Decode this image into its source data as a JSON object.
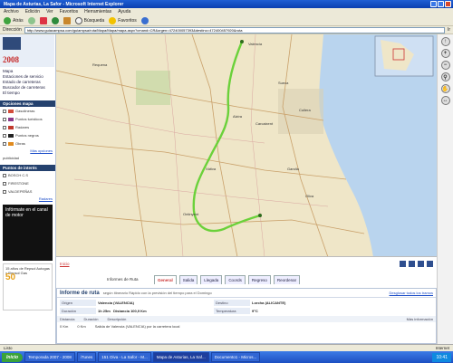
{
  "window": {
    "title": "Mapa de Asturias, La Safor - Microsoft Internet Explorer"
  },
  "menu": [
    "Archivo",
    "Edición",
    "Ver",
    "Favoritos",
    "Herramientas",
    "Ayuda"
  ],
  "toolbar": {
    "back": "Atrás",
    "search": "Búsqueda",
    "favorites": "Favoritos"
  },
  "address": {
    "label": "Dirección",
    "url": "http://www.guiacampsa.com/guiampsa/ruta/Mapa/Mapa/mapa.aspx?cmand=CR&orgen=472400057393&destino=472400457920&ruta",
    "go": "Ir"
  },
  "sidebar": {
    "year": "2008",
    "links": [
      "Mapa",
      "Estaciones de servicio",
      "Estado de carreteras",
      "Buscador de carreteras",
      "El tiempo"
    ],
    "options_title": "Opciones mapa",
    "options": [
      {
        "label": "Gasolineras",
        "color": "#d24c3a"
      },
      {
        "label": "Puntos turísticos",
        "color": "#8b3a8b"
      },
      {
        "label": "Radares",
        "color": "#c0392b"
      },
      {
        "label": "Puntos negros",
        "color": "#222"
      },
      {
        "label": "Obras",
        "color": "#e08a1e"
      }
    ],
    "more_options": "Más opciones",
    "pub_title": "publicidad",
    "points_title": "Puntos de interés",
    "points": [
      "BOSCH C.S",
      "FIRESTONE",
      "VALDEPEÑAS"
    ],
    "radars_link": "Radares",
    "ad1": "Infórmate en el canal de motor",
    "ad2_line": "15 años de Repsol Autogas y Repsol Gas",
    "ad2_big": "50"
  },
  "map": {
    "cities": [
      "Valencia",
      "Alzira",
      "Carcaixent",
      "Xàtiva",
      "Gandia",
      "Oliva",
      "Ontinyent",
      "Sueca",
      "Cullera",
      "Requena"
    ],
    "sea_color": "#b9d4ee",
    "route_color": "#6bd13a"
  },
  "under": {
    "link": "Inicio"
  },
  "tabs": {
    "lead": "Informes de Ruta",
    "items": [
      "General",
      "Salida",
      "Llegada",
      "Coords",
      "Regreso",
      "Reordenar"
    ],
    "active": 0
  },
  "report": {
    "title": "Informe de ruta",
    "subtitle": "según itinerario Rápido con la previsión del tiempo para el Domingo",
    "detail_link": "Desglosar todos los tramos",
    "origin_label": "Origen",
    "origin": "Valencia (VALENCIA)",
    "dest_label": "Destino",
    "dest": "Lorcha (ALICANTE)",
    "duration_label": "Duración",
    "duration": "1h 25m",
    "distance_label": "Distancia",
    "distance": "100,9 Km",
    "temp_label": "Temperatura",
    "temp": "9°C",
    "summary": [
      "Distancia",
      "Duración",
      "Descripción",
      "Más información"
    ],
    "step": [
      "0 Km",
      "0 Km",
      "Salida de Valencia (VALENCIA) por la carretera local"
    ]
  },
  "status": {
    "left": "Listo",
    "zone": "Internet"
  },
  "taskbar": {
    "start": "Inicio",
    "tasks": [
      "Temporada 2007 - 2008",
      "iTunes",
      "151 Oiva - La Safor - M...",
      "Mapa de Asturias, La Saf...",
      "Documento1 - Micros..."
    ],
    "active": 3,
    "clock": "10:41"
  }
}
